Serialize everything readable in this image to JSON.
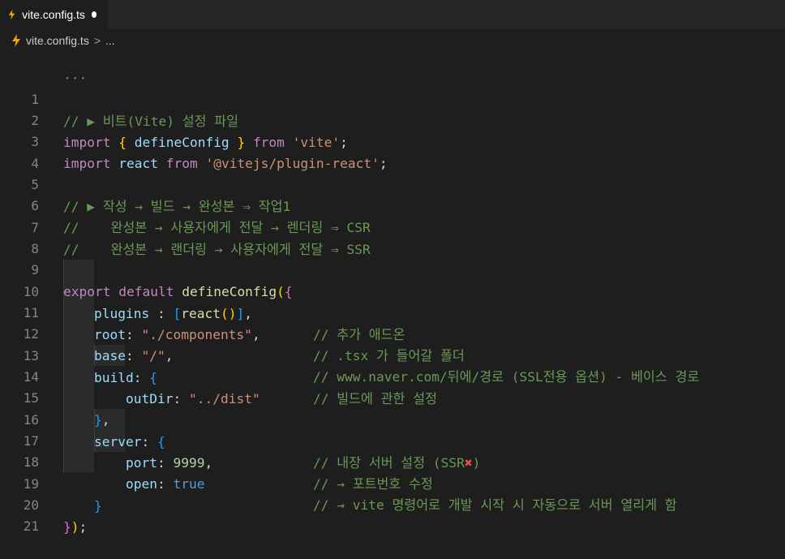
{
  "tab": {
    "filename": "vite.config.ts"
  },
  "breadcrumbs": {
    "file": "vite.config.ts",
    "separator": ">",
    "more": "..."
  },
  "editor": {
    "folded_marker": "···",
    "line_numbers": [
      "1",
      "2",
      "3",
      "4",
      "5",
      "6",
      "7",
      "8",
      "9",
      "10",
      "11",
      "12",
      "13",
      "14",
      "15",
      "16",
      "17",
      "18",
      "19",
      "20",
      "21"
    ],
    "lines": {
      "l1_comment": "// ▶ 비트(Vite) 설정 파일",
      "l2_import": "import",
      "l2_brace_open": "{",
      "l2_name": "defineConfig",
      "l2_brace_close": "}",
      "l2_from": "from",
      "l2_source": "'vite'",
      "l2_semi": ";",
      "l3_import": "import",
      "l3_name": "react",
      "l3_from": "from",
      "l3_source": "'@vitejs/plugin-react'",
      "l3_semi": ";",
      "l5_comment": "// ▶ 작성 → 빌드 → 완성본 ⇒ 작업1",
      "l6_comment": "//    완성본 → 사용자에게 전달 → 렌더링 ⇒ CSR",
      "l7_comment": "//    완성본 → 랜더링 → 사용자에게 전달 ⇒ SSR",
      "l9_export": "export",
      "l9_default": "default",
      "l9_fn": "defineConfig",
      "l10_key": "plugins",
      "l10_colon": " :",
      "l10_fn": "react",
      "l10_comment": "// 추가 애드온",
      "l11_key": "root",
      "l11_value": "\"./components\"",
      "l11_comment": "// .tsx 가 들어갈 폴더",
      "l12_key": "base",
      "l12_value": "\"/\"",
      "l12_comment": "// www.naver.com/뒤에/경로 (SSL전용 옵션) - 베이스 경로",
      "l13_key": "build",
      "l13_comment": "// 빌드에 관한 설정",
      "l14_key": "outDir",
      "l14_value": "\"../dist\"",
      "l16_key": "server",
      "l16_comment_a": "// 내장 서버 설정 (SSR",
      "l16_comment_mark": "✖",
      "l16_comment_b": ")",
      "l17_key": "port",
      "l17_value": "9999",
      "l17_comment": "// → 포트번호 수정",
      "l18_key": "open",
      "l18_value": "true",
      "l18_comment": "// → vite 명령어로 개발 시작 시 자동으로 서버 열리게 함"
    }
  },
  "colors": {
    "keyword": "#c586c0",
    "function": "#dcdcaa",
    "variable": "#9cdcfe",
    "string": "#ce9178",
    "number": "#b5cea8",
    "comment": "#6a9955",
    "constant": "#569cd6",
    "bracket_gold": "#ffd700",
    "bracket_violet": "#da70d6",
    "bracket_blue": "#179fff",
    "bolt_icon": "#f0a30a"
  },
  "icons": {
    "file_icon": "lightning-bolt-icon",
    "dirty_indicator": "unsaved-dot-icon"
  }
}
